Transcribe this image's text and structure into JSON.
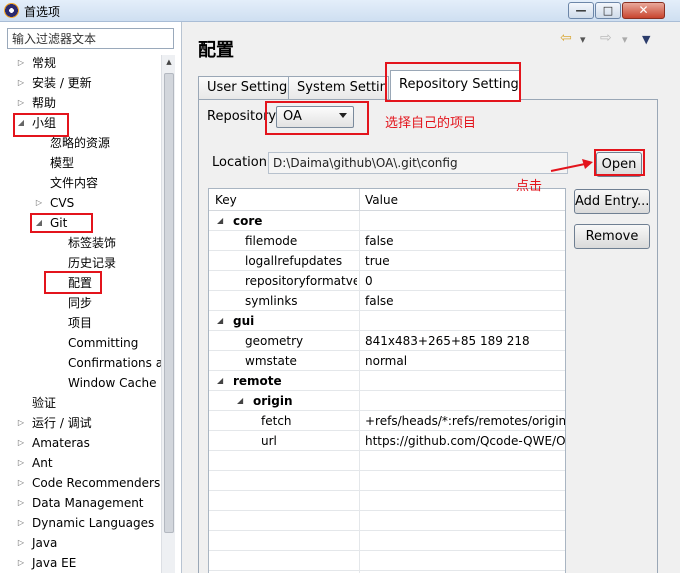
{
  "window": {
    "title": "首选项",
    "minimize_glyph": "—",
    "maximize_glyph": "□",
    "close_glyph": "✕"
  },
  "filter": {
    "placeholder": "输入过滤器文本"
  },
  "tree": [
    {
      "label": "常规",
      "level": 0,
      "state": "collapsed"
    },
    {
      "label": "安装 / 更新",
      "level": 0,
      "state": "collapsed"
    },
    {
      "label": "帮助",
      "level": 0,
      "state": "collapsed"
    },
    {
      "label": "小组",
      "level": 0,
      "state": "expanded"
    },
    {
      "label": "忽略的资源",
      "level": 1,
      "state": "leaf"
    },
    {
      "label": "模型",
      "level": 1,
      "state": "leaf"
    },
    {
      "label": "文件内容",
      "level": 1,
      "state": "leaf"
    },
    {
      "label": "CVS",
      "level": 1,
      "state": "collapsed"
    },
    {
      "label": "Git",
      "level": 1,
      "state": "expanded"
    },
    {
      "label": "标签装饰",
      "level": 2,
      "state": "leaf"
    },
    {
      "label": "历史记录",
      "level": 2,
      "state": "leaf"
    },
    {
      "label": "配置",
      "level": 2,
      "state": "leaf"
    },
    {
      "label": "同步",
      "level": 2,
      "state": "leaf"
    },
    {
      "label": "项目",
      "level": 2,
      "state": "leaf"
    },
    {
      "label": "Committing",
      "level": 2,
      "state": "leaf"
    },
    {
      "label": "Confirmations a",
      "level": 2,
      "state": "leaf"
    },
    {
      "label": "Window Cache",
      "level": 2,
      "state": "leaf"
    },
    {
      "label": "验证",
      "level": 0,
      "state": "leaf"
    },
    {
      "label": "运行 / 调试",
      "level": 0,
      "state": "collapsed"
    },
    {
      "label": "Amateras",
      "level": 0,
      "state": "collapsed"
    },
    {
      "label": "Ant",
      "level": 0,
      "state": "collapsed"
    },
    {
      "label": "Code Recommenders",
      "level": 0,
      "state": "collapsed"
    },
    {
      "label": "Data Management",
      "level": 0,
      "state": "collapsed"
    },
    {
      "label": "Dynamic Languages",
      "level": 0,
      "state": "collapsed"
    },
    {
      "label": "Java",
      "level": 0,
      "state": "collapsed"
    },
    {
      "label": "Java EE",
      "level": 0,
      "state": "collapsed"
    }
  ],
  "page": {
    "title": "配置"
  },
  "nav": {
    "back_glyph": "⇦",
    "menu_glyph": "▾",
    "forward_glyph": "⇨",
    "view_menu_glyph": "▼"
  },
  "tabs": [
    "User Settings",
    "System Settings",
    "Repository Settings"
  ],
  "repository": {
    "label": "Repository:",
    "value": "OA"
  },
  "location": {
    "label": "Location:",
    "value": "D:\\Daima\\github\\OA\\.git\\config"
  },
  "buttons": {
    "open": "Open",
    "add_entry": "Add Entry...",
    "remove": "Remove"
  },
  "grid": {
    "headers": [
      "Key",
      "Value"
    ],
    "rows": [
      {
        "key": "core",
        "value": "",
        "level": 0,
        "group": true
      },
      {
        "key": "filemode",
        "value": "false",
        "level": 1,
        "group": false
      },
      {
        "key": "logallrefupdates",
        "value": "true",
        "level": 1,
        "group": false
      },
      {
        "key": "repositoryformatve",
        "value": "0",
        "level": 1,
        "group": false
      },
      {
        "key": "symlinks",
        "value": "false",
        "level": 1,
        "group": false
      },
      {
        "key": "gui",
        "value": "",
        "level": 0,
        "group": true
      },
      {
        "key": "geometry",
        "value": "841x483+265+85 189 218",
        "level": 1,
        "group": false
      },
      {
        "key": "wmstate",
        "value": "normal",
        "level": 1,
        "group": false
      },
      {
        "key": "remote",
        "value": "",
        "level": 0,
        "group": true
      },
      {
        "key": "origin",
        "value": "",
        "level": 1,
        "group": true
      },
      {
        "key": "fetch",
        "value": "+refs/heads/*:refs/remotes/origin/",
        "level": 2,
        "group": false
      },
      {
        "key": "url",
        "value": "https://github.com/Qcode-QWE/OA",
        "level": 2,
        "group": false
      }
    ]
  },
  "annotations": {
    "select_repo": "选择自己的项目",
    "click": "点击"
  },
  "colors": {
    "annotation_red": "#e3141c"
  }
}
